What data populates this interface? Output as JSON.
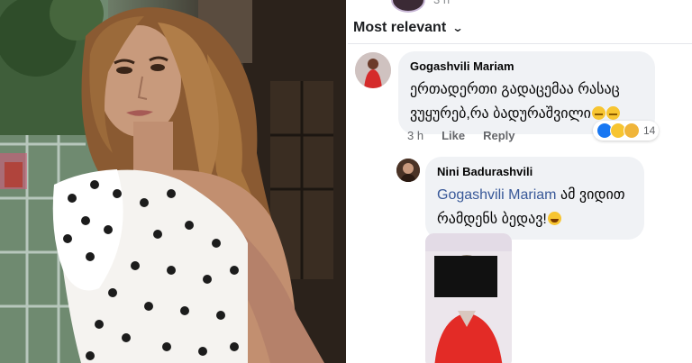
{
  "post": {
    "time": "3 h",
    "sort_label": "Most relevant"
  },
  "comments": [
    {
      "author": "Gogashvili Mariam",
      "text": "ერთადერთი გადაცემაა რასაც ვუყურებ,რა ბადურაშვილი",
      "time": "3 h",
      "like_label": "Like",
      "reply_label": "Reply",
      "reaction_count": "14"
    }
  ],
  "reply": {
    "author": "Nini Badurashvili",
    "mention": "Gogashvili Mariam",
    "text": "ამ ვიდით რამდენს ბედავ!"
  },
  "colors": {
    "bubble": "#f0f2f5",
    "mention": "#385898",
    "meta": "#65676b",
    "like_blue": "#1877f2"
  },
  "icons": [
    "chevron-down-icon",
    "like-reaction-icon",
    "haha-reaction-icon",
    "sad-reaction-icon",
    "grin-emoji-icon",
    "laugh-emoji-icon"
  ]
}
